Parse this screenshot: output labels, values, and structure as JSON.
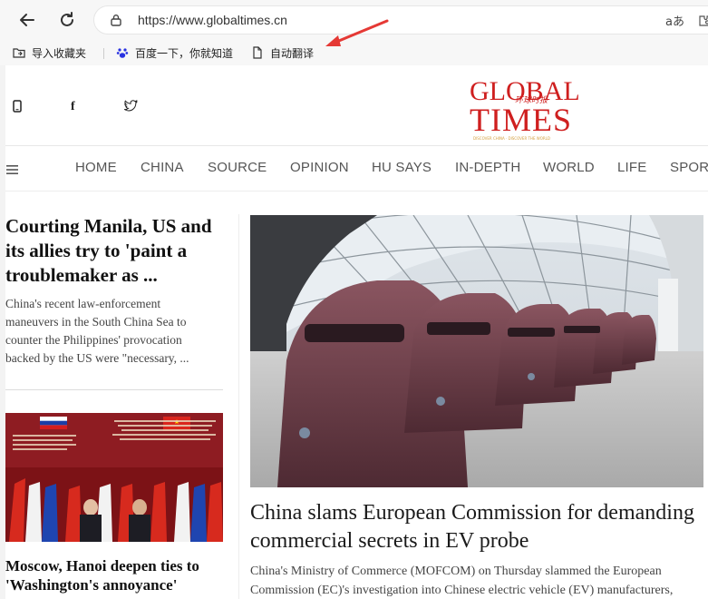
{
  "browser": {
    "url": "https://www.globaltimes.cn",
    "read_aloud": "aあ",
    "bookmarks": [
      {
        "label": "导入收藏夹"
      },
      {
        "label": "百度一下，你就知道"
      },
      {
        "label": "自动翻译"
      }
    ]
  },
  "site": {
    "logo_line1": "GLOBAL",
    "logo_line2": "TIMES",
    "logo_chinese": "环球时报",
    "logo_tagline": "DISCOVER CHINA · DISCOVER THE WORLD",
    "social": {
      "mobile": "▯",
      "facebook": "f",
      "twitter": "🐦"
    },
    "nav": [
      "HOME",
      "CHINA",
      "SOURCE",
      "OPINION",
      "HU SAYS",
      "IN-DEPTH",
      "WORLD",
      "LIFE",
      "SPORT"
    ]
  },
  "stories": {
    "left_top": {
      "title": "Courting Manila, US and its allies try to 'paint a troublemaker as ...",
      "summary": "China's recent law-enforcement maneuvers in the South China Sea to counter the Philippines' provocation backed by the US were \"necessary, ..."
    },
    "left_bottom": {
      "title": "Moscow, Hanoi deepen ties to 'Washington's annoyance'"
    },
    "main": {
      "title": "China slams European Commission for demanding commercial secrets in EV probe",
      "summary": "China's Ministry of Commerce (MOFCOM) on Thursday slammed the European Commission (EC)'s investigation into Chinese electric vehicle (EV) manufacturers,"
    }
  },
  "colors": {
    "brand_red": "#cf1f1f",
    "annotation_arrow": "#e53935"
  }
}
